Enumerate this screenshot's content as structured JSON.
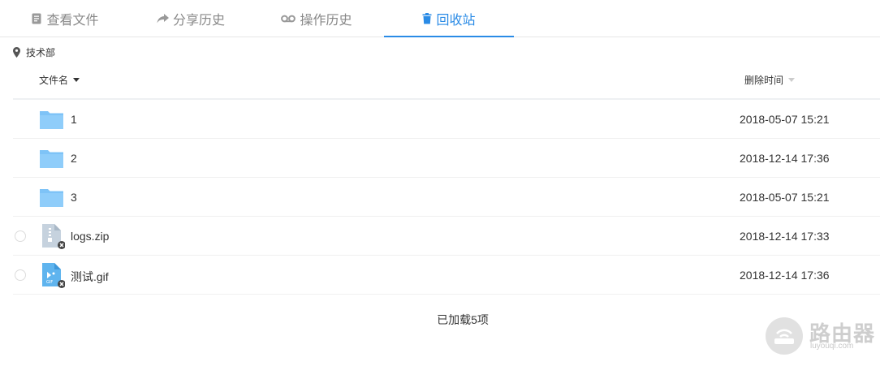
{
  "tabs": [
    {
      "label": "查看文件",
      "icon": "file-list-icon",
      "active": false
    },
    {
      "label": "分享历史",
      "icon": "share-icon",
      "active": false
    },
    {
      "label": "操作历史",
      "icon": "history-icon",
      "active": false
    },
    {
      "label": "回收站",
      "icon": "trash-icon",
      "active": true
    }
  ],
  "breadcrumb": {
    "label": "技术部",
    "icon": "location-pin-icon"
  },
  "table": {
    "columns": {
      "name": "文件名",
      "deleted_time": "删除时间"
    },
    "rows": [
      {
        "name": "1",
        "type": "folder",
        "time": "2018-05-07 15:21"
      },
      {
        "name": "2",
        "type": "folder",
        "time": "2018-12-14 17:36"
      },
      {
        "name": "3",
        "type": "folder",
        "time": "2018-05-07 15:21"
      },
      {
        "name": "logs.zip",
        "type": "zip",
        "time": "2018-12-14 17:33"
      },
      {
        "name": "测试.gif",
        "type": "gif",
        "time": "2018-12-14 17:36"
      }
    ]
  },
  "footer": {
    "status": "已加载5项"
  },
  "watermark": {
    "title": "路由器",
    "subtitle": "luyouqi.com"
  },
  "colors": {
    "accent": "#2a8be6",
    "folder": "#7ec3f7",
    "zip": "#c6d2de",
    "gif": "#5fb4ee"
  }
}
